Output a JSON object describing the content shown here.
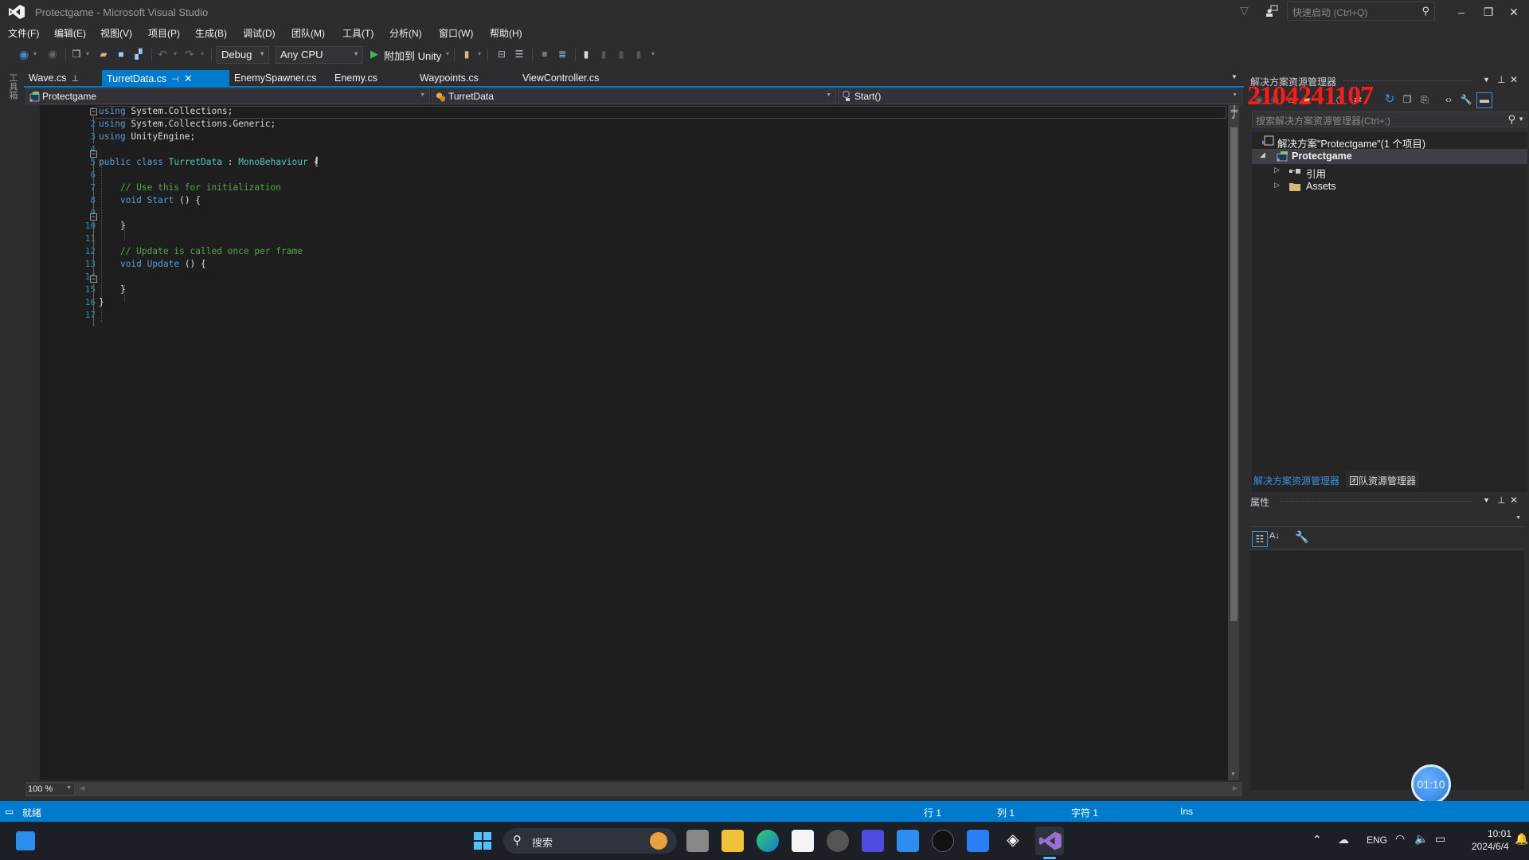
{
  "window": {
    "title": "Protectgame - Microsoft Visual Studio",
    "quick_launch_placeholder": "快速启动 (Ctrl+Q)",
    "controls": {
      "minimize": "–",
      "restore": "❐",
      "close": "✕"
    }
  },
  "menu": {
    "items": [
      "文件(F)",
      "编辑(E)",
      "视图(V)",
      "项目(P)",
      "生成(B)",
      "调试(D)",
      "团队(M)",
      "工具(T)",
      "分析(N)",
      "窗口(W)",
      "帮助(H)"
    ]
  },
  "toolbar": {
    "configuration": "Debug",
    "platform": "Any CPU",
    "attach_label": "附加到 Unity",
    "icons": [
      "back-icon",
      "forward-icon",
      "new-project-icon",
      "open-file-icon",
      "save-icon",
      "save-all-icon",
      "undo-icon",
      "redo-icon",
      "play-icon",
      "find-icon",
      "step-icon",
      "format-icon",
      "comment-icon",
      "uncomment-icon",
      "bookmark-icon",
      "prev-bookmark-icon",
      "next-bookmark-icon",
      "clear-bookmark-icon"
    ]
  },
  "left_strip": {
    "toolbox_label": "工具箱"
  },
  "tabs": [
    {
      "label": "Wave.cs",
      "pinned": true,
      "active": false
    },
    {
      "label": "TurretData.cs",
      "pinned": true,
      "active": true
    },
    {
      "label": "EnemySpawner.cs",
      "pinned": false,
      "active": false
    },
    {
      "label": "Enemy.cs",
      "pinned": false,
      "active": false
    },
    {
      "label": "Waypoints.cs",
      "pinned": false,
      "active": false
    },
    {
      "label": "ViewController.cs",
      "pinned": false,
      "active": false
    }
  ],
  "navbar": {
    "project": "Protectgame",
    "type": "TurretData",
    "member": "Start()"
  },
  "editor": {
    "line_numbers": [
      "1",
      "2",
      "3",
      "4",
      "5",
      "6",
      "7",
      "8",
      "9",
      "10",
      "11",
      "12",
      "13",
      "14",
      "15",
      "16",
      "17"
    ],
    "lines": [
      [
        {
          "t": "using",
          "c": "kw"
        },
        {
          "t": " System.Collections;",
          "c": ""
        }
      ],
      [
        {
          "t": "using",
          "c": "kw"
        },
        {
          "t": " System.Collections.Generic;",
          "c": ""
        }
      ],
      [
        {
          "t": "using",
          "c": "kw"
        },
        {
          "t": " UnityEngine;",
          "c": ""
        }
      ],
      [],
      [
        {
          "t": "public",
          "c": "kw"
        },
        {
          "t": " ",
          "c": ""
        },
        {
          "t": "class",
          "c": "kw"
        },
        {
          "t": " ",
          "c": ""
        },
        {
          "t": "TurretData",
          "c": "ty"
        },
        {
          "t": " : ",
          "c": ""
        },
        {
          "t": "MonoBehaviour",
          "c": "ty"
        },
        {
          "t": " {",
          "c": ""
        }
      ],
      [],
      [
        {
          "t": "    // Use this for initialization",
          "c": "cm"
        }
      ],
      [
        {
          "t": "    ",
          "c": ""
        },
        {
          "t": "void",
          "c": "kw"
        },
        {
          "t": " ",
          "c": ""
        },
        {
          "t": "Start",
          "c": "kw"
        },
        {
          "t": " () {",
          "c": ""
        }
      ],
      [],
      [
        {
          "t": "    }",
          "c": ""
        }
      ],
      [],
      [
        {
          "t": "    // Update is called once per frame",
          "c": "cm"
        }
      ],
      [
        {
          "t": "    ",
          "c": ""
        },
        {
          "t": "void",
          "c": "kw"
        },
        {
          "t": " ",
          "c": ""
        },
        {
          "t": "Update",
          "c": "kw"
        },
        {
          "t": " () {",
          "c": ""
        }
      ],
      [],
      [
        {
          "t": "    }",
          "c": ""
        }
      ],
      [
        {
          "t": "}",
          "c": ""
        }
      ],
      []
    ],
    "zoom_level": "100 %"
  },
  "status_bar": {
    "state": "就绪",
    "line": "行 1",
    "column": "列 1",
    "char": "字符 1",
    "mode": "Ins"
  },
  "solution_explorer": {
    "title": "解决方案资源管理器",
    "search_placeholder": "搜索解决方案资源管理器(Ctrl+;)",
    "tree": [
      {
        "label": "解决方案\"Protectgame\"(1 个项目)",
        "level": 0,
        "icon": "solution-icon",
        "expander": ""
      },
      {
        "label": "Protectgame",
        "level": 1,
        "icon": "csharp-project-icon",
        "expander": "◢",
        "bold": true,
        "selected": true
      },
      {
        "label": "引用",
        "level": 2,
        "icon": "references-icon",
        "expander": "▷"
      },
      {
        "label": "Assets",
        "level": 2,
        "icon": "folder-icon",
        "expander": "▷"
      }
    ],
    "bottom_tabs": [
      "解决方案资源管理器",
      "团队资源管理器"
    ],
    "watermark": "2104241107"
  },
  "properties": {
    "title": "属性"
  },
  "overlay": {
    "timer": "01:10"
  },
  "taskbar": {
    "search_placeholder": "搜索",
    "apps": [
      "task-view-icon",
      "file-explorer-icon",
      "edge-icon",
      "store-icon",
      "app-icon",
      "app-icon",
      "app-icon",
      "app-icon",
      "app-icon",
      "unity-icon",
      "visual-studio-icon"
    ],
    "tray": {
      "language": "ENG",
      "time": "10:01",
      "date": "2024/6/4"
    }
  },
  "colors": {
    "accent": "#007acc",
    "keyword": "#569cd6",
    "type": "#4ec9b0",
    "comment": "#57a64a",
    "line_number": "#2b91af",
    "watermark": "#ff1a1a"
  }
}
